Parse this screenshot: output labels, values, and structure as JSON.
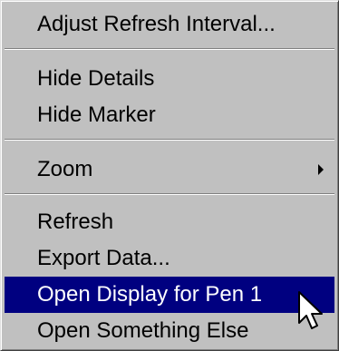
{
  "menu": {
    "items": [
      {
        "label": "Adjust Refresh Interval..."
      },
      {
        "label": "Hide Details"
      },
      {
        "label": "Hide Marker"
      },
      {
        "label": "Zoom",
        "submenu_icon": "chevron-right-icon"
      },
      {
        "label": "Refresh"
      },
      {
        "label": "Export Data..."
      },
      {
        "label": "Open Display for Pen 1",
        "highlighted": true
      },
      {
        "label": "Open Something Else"
      }
    ]
  },
  "colors": {
    "menu_background": "#c0c0c0",
    "highlight_background": "#000080",
    "highlight_text": "#ffffff",
    "text": "#000000"
  },
  "cursor_icon": "mouse-pointer-icon"
}
